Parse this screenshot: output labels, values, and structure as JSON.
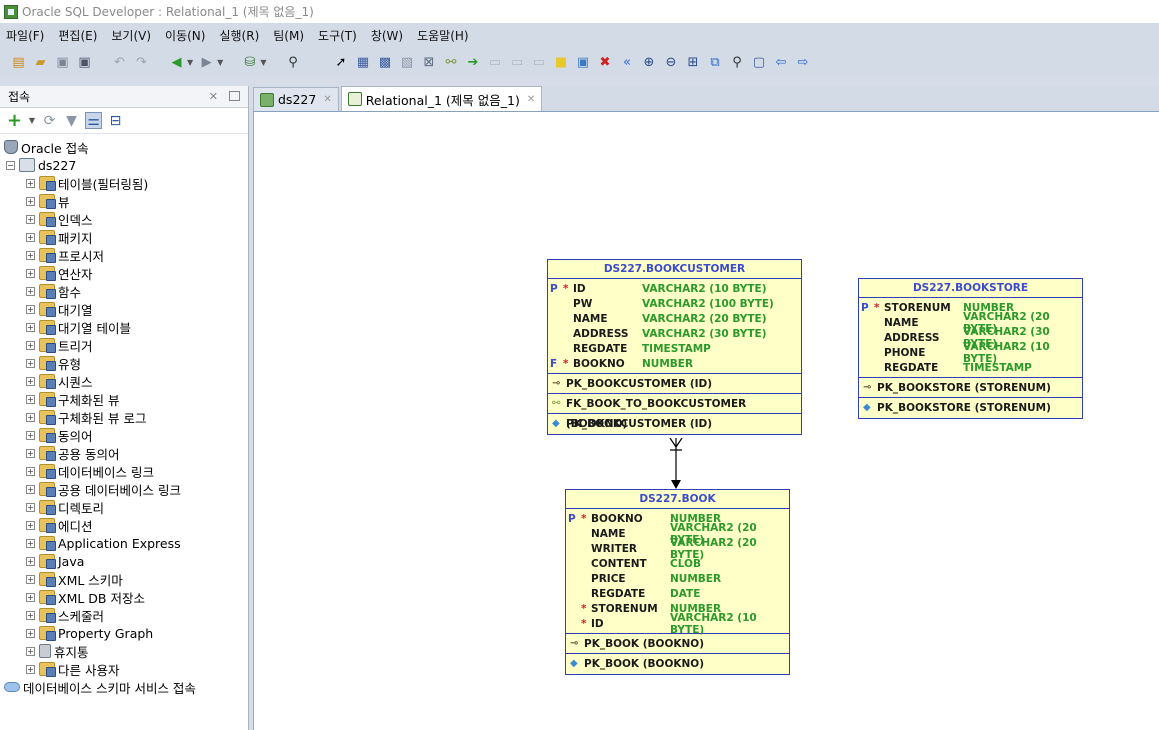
{
  "window": {
    "title": "Oracle SQL Developer : Relational_1 (제목 없음_1)"
  },
  "menu": [
    "파일(F)",
    "편집(E)",
    "보기(V)",
    "이동(N)",
    "실행(R)",
    "팀(M)",
    "도구(T)",
    "창(W)",
    "도움말(H)"
  ],
  "left_panel": {
    "title": "접속",
    "tree": {
      "root": "Oracle 접속",
      "connection": "ds227",
      "items": [
        "테이블(필터링됨)",
        "뷰",
        "인덱스",
        "패키지",
        "프로시저",
        "연산자",
        "함수",
        "대기열",
        "대기열 테이블",
        "트리거",
        "유형",
        "시퀀스",
        "구체화된 뷰",
        "구체화된 뷰 로그",
        "동의어",
        "공용 동의어",
        "데이터베이스 링크",
        "공용 데이터베이스 링크",
        "디렉토리",
        "에디션",
        "Application Express",
        "Java",
        "XML 스키마",
        "XML DB 저장소",
        "스케줄러",
        "Property Graph",
        "휴지통",
        "다른 사용자"
      ],
      "footer": "데이터베이스 스키마 서비스 접속"
    }
  },
  "tabs": [
    {
      "label": "ds227",
      "active": false
    },
    {
      "label": "Relational_1 (제목 없음_1)",
      "active": true
    }
  ],
  "diagram": {
    "bookcustomer": {
      "title": "DS227.BOOKCUSTOMER",
      "columns": [
        {
          "flag": "P",
          "req": "*",
          "name": "ID",
          "type": "VARCHAR2 (10 BYTE)"
        },
        {
          "flag": "",
          "req": "",
          "name": "PW",
          "type": "VARCHAR2 (100 BYTE)"
        },
        {
          "flag": "",
          "req": "",
          "name": "NAME",
          "type": "VARCHAR2 (20 BYTE)"
        },
        {
          "flag": "",
          "req": "",
          "name": "ADDRESS",
          "type": "VARCHAR2 (30 BYTE)"
        },
        {
          "flag": "",
          "req": "",
          "name": "REGDATE",
          "type": "TIMESTAMP"
        },
        {
          "flag": "F",
          "req": "*",
          "name": "BOOKNO",
          "type": "NUMBER"
        }
      ],
      "keys": [
        "PK_BOOKCUSTOMER (ID)",
        "FK_BOOK_TO_BOOKCUSTOMER (BOOKNO)",
        "PK_BOOKCUSTOMER (ID)"
      ]
    },
    "bookstore": {
      "title": "DS227.BOOKSTORE",
      "columns": [
        {
          "flag": "P",
          "req": "*",
          "name": "STORENUM",
          "type": "NUMBER"
        },
        {
          "flag": "",
          "req": "",
          "name": "NAME",
          "type": "VARCHAR2 (20 BYTE)"
        },
        {
          "flag": "",
          "req": "",
          "name": "ADDRESS",
          "type": "VARCHAR2 (30 BYTE)"
        },
        {
          "flag": "",
          "req": "",
          "name": "PHONE",
          "type": "VARCHAR2 (10 BYTE)"
        },
        {
          "flag": "",
          "req": "",
          "name": "REGDATE",
          "type": "TIMESTAMP"
        }
      ],
      "keys": [
        "PK_BOOKSTORE (STORENUM)",
        "PK_BOOKSTORE (STORENUM)"
      ]
    },
    "book": {
      "title": "DS227.BOOK",
      "columns": [
        {
          "flag": "P",
          "req": "*",
          "name": "BOOKNO",
          "type": "NUMBER"
        },
        {
          "flag": "",
          "req": "",
          "name": "NAME",
          "type": "VARCHAR2 (20 BYTE)"
        },
        {
          "flag": "",
          "req": "",
          "name": "WRITER",
          "type": "VARCHAR2 (20 BYTE)"
        },
        {
          "flag": "",
          "req": "",
          "name": "CONTENT",
          "type": "CLOB"
        },
        {
          "flag": "",
          "req": "",
          "name": "PRICE",
          "type": "NUMBER"
        },
        {
          "flag": "",
          "req": "",
          "name": "REGDATE",
          "type": "DATE"
        },
        {
          "flag": "",
          "req": "*",
          "name": "STORENUM",
          "type": "NUMBER"
        },
        {
          "flag": "",
          "req": "*",
          "name": "ID",
          "type": "VARCHAR2 (10 BYTE)"
        }
      ],
      "keys": [
        "PK_BOOK (BOOKNO)",
        "PK_BOOK (BOOKNO)"
      ]
    }
  }
}
